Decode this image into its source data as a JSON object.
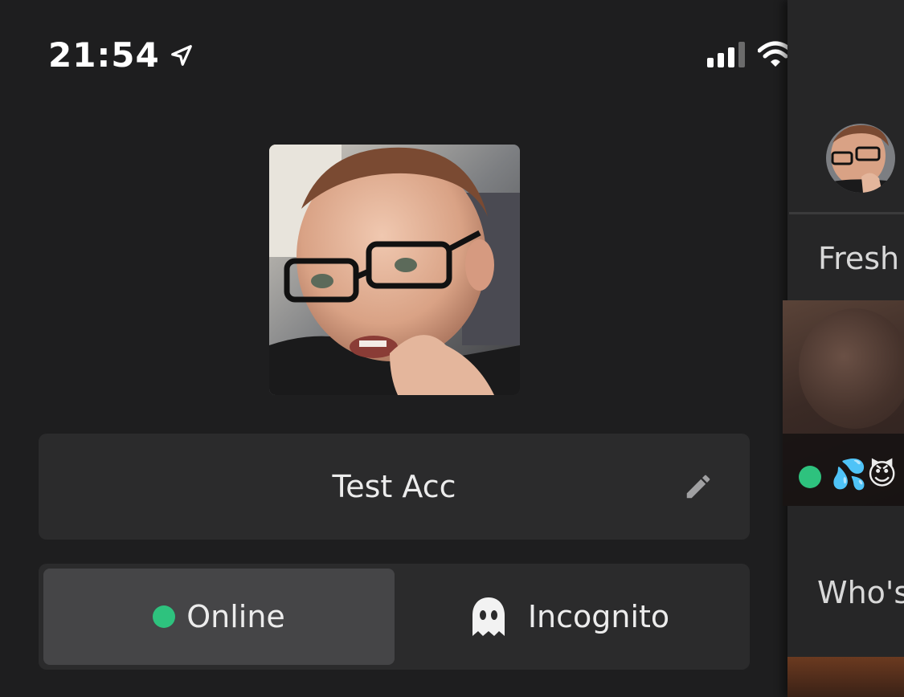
{
  "status_bar": {
    "time": "21:54",
    "location_icon": "location-arrow-icon",
    "signal_icon": "cellular-signal-icon",
    "wifi_icon": "wifi-icon",
    "battery_icon": "battery-icon"
  },
  "profile": {
    "display_name": "Test Acc",
    "edit_icon": "pencil-icon"
  },
  "presence": {
    "options": [
      {
        "label": "Online",
        "icon": "green-dot-icon",
        "selected": true
      },
      {
        "label": "Incognito",
        "icon": "ghost-icon",
        "selected": false
      }
    ]
  },
  "peek_panel": {
    "section_title": "Fresh",
    "card_emoji": "💦😈",
    "section_title_2": "Who's"
  },
  "colors": {
    "background": "#1e1e1f",
    "card": "#2b2b2c",
    "selected": "#454547",
    "online_green": "#2ec27e"
  }
}
